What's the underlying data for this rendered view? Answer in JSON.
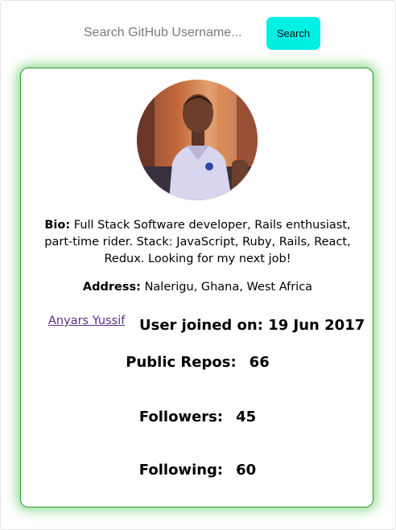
{
  "search": {
    "placeholder": "Search GitHub Username...",
    "button_label": "Search",
    "button_color": "#00f0e4"
  },
  "profile": {
    "bio_label": "Bio:",
    "bio_text": "Full Stack Software developer, Rails enthusiast, part-time rider. Stack: JavaScript, Ruby, Rails, React, Redux. Looking for my next job!",
    "address_label": "Address:",
    "address_text": "Nalerigu, Ghana, West Africa",
    "name": "Anyars Yussif",
    "joined_label": "User joined on:",
    "joined_date": "19 Jun 2017"
  },
  "stats": {
    "repos_label": "Public Repos:",
    "repos": "66",
    "followers_label": "Followers:",
    "followers": "45",
    "following_label": "Following:",
    "following": "60"
  },
  "colors": {
    "card_glow": "#3cbe3c",
    "link": "#5b2d86"
  },
  "icons": {
    "avatar": "user-avatar-photo"
  }
}
